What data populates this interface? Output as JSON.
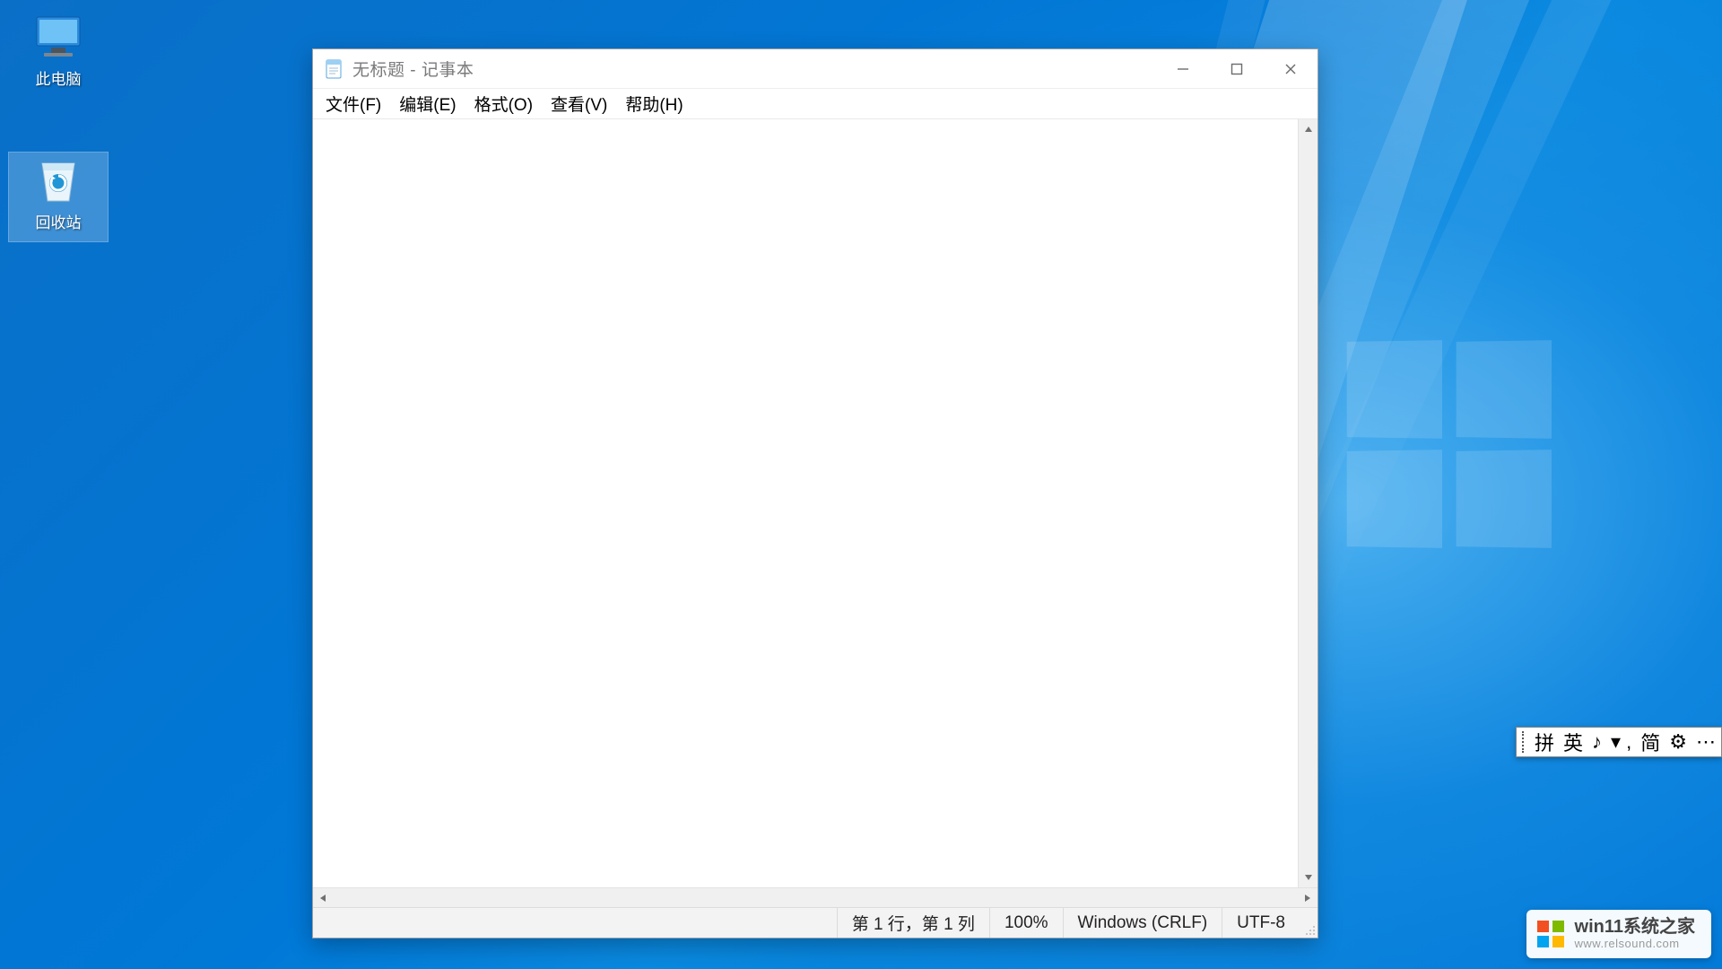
{
  "desktop": {
    "icons": {
      "this_pc": {
        "label": "此电脑"
      },
      "recycle_bin": {
        "label": "回收站"
      }
    }
  },
  "notepad": {
    "title": "无标题 - 记事本",
    "menu": {
      "file": "文件(F)",
      "edit": "编辑(E)",
      "format": "格式(O)",
      "view": "查看(V)",
      "help": "帮助(H)"
    },
    "content": "",
    "status": {
      "position": "第 1 行，第 1 列",
      "zoom": "100%",
      "eol": "Windows (CRLF)",
      "encoding": "UTF-8"
    }
  },
  "ime": {
    "items": [
      "拼",
      "英",
      "♪",
      "▾ ,",
      "简",
      "⚙",
      "⋯"
    ]
  },
  "watermark": {
    "title": "win11系统之家",
    "url": "www.relsound.com"
  }
}
